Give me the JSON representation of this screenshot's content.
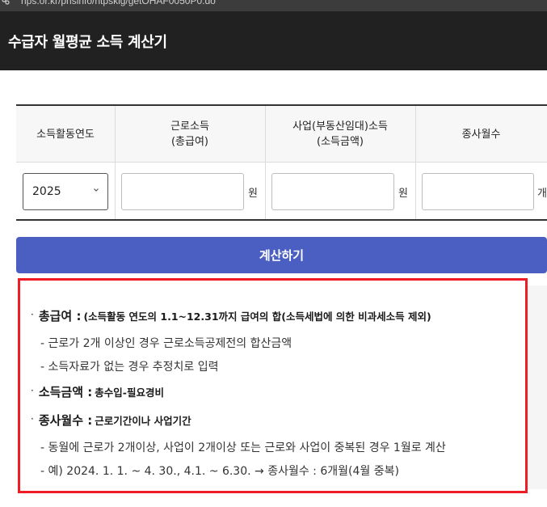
{
  "browser": {
    "url": "nps.or.kr/pnsinfo/ntpsklg/getOHAF0050P0.do"
  },
  "header": {
    "title": "수급자 월평균 소득 계산기"
  },
  "table": {
    "col_year": "소득활동연도",
    "col_wage_line1": "근로소득",
    "col_wage_line2": "(총급여)",
    "col_business_line1": "사업(부동산임대)소득",
    "col_business_line2": "(소득금액)",
    "col_months": "종사월수",
    "year_value": "2025",
    "wage_value": "",
    "business_value": "",
    "months_value": "",
    "unit_won": "원",
    "unit_months": "개"
  },
  "calc_button": "계산하기",
  "info": {
    "term1_name": "총급여 :",
    "term1_desc": "(소득활동 연도의 1.1~12.31까지 급여의 합(소득세법에 의한 비과세소득 제외)",
    "term1_note1": "- 근로가 2개 이상인 경우 근로소득공제전의 합산금액",
    "term1_note2": "- 소득자료가 없는 경우 추정치로 입력",
    "term2_name": "소득금액 :",
    "term2_desc": "총수입-필요경비",
    "term3_name": "종사월수 :",
    "term3_desc": "근로기간이나 사업기간",
    "term3_note1": "- 동월에 근로가 2개이상, 사업이 2개이상 또는 근로와 사업이 중복된 경우 1월로 계산",
    "term3_note2": "- 예) 2024. 1. 1. ~ 4. 30., 4.1. ~ 6.30. → 종사월수 : 6개월(4월 중복)"
  },
  "colors": {
    "header_bg": "#212121",
    "button_bg": "#4a5fc1",
    "highlight_border": "#ee1c24"
  }
}
